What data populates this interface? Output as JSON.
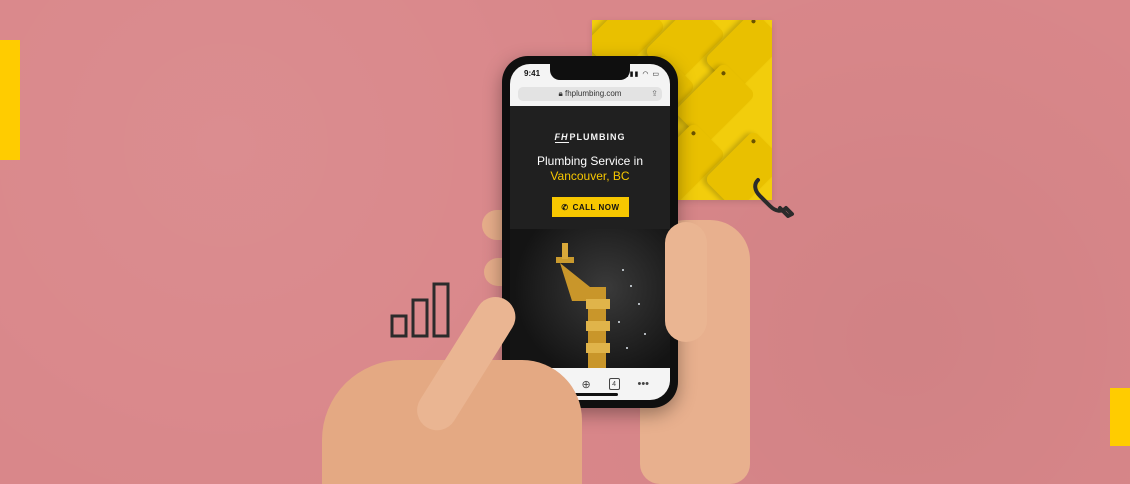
{
  "phone": {
    "status_time": "9:41",
    "status_icons": "▮▮▮ ◠ ▭",
    "url": "fhplumbing.com",
    "logo_fh": "FH",
    "logo_text": "PLUMBING",
    "hero_line1": "Plumbing Service in",
    "hero_line2": "Vancouver, BC",
    "cta_label": "CALL NOW",
    "cta_icon": "phone-icon",
    "tab_count": "4"
  },
  "colors": {
    "background": "#d9878a",
    "accent_yellow": "#f7c700",
    "screen_dark": "#202020"
  },
  "icons": [
    "bar-chart-icon",
    "telephone-receiver-icon",
    "lock-icon",
    "share-icon",
    "back-icon",
    "forward-icon",
    "new-tab-icon",
    "tabs-icon",
    "more-icon"
  ]
}
